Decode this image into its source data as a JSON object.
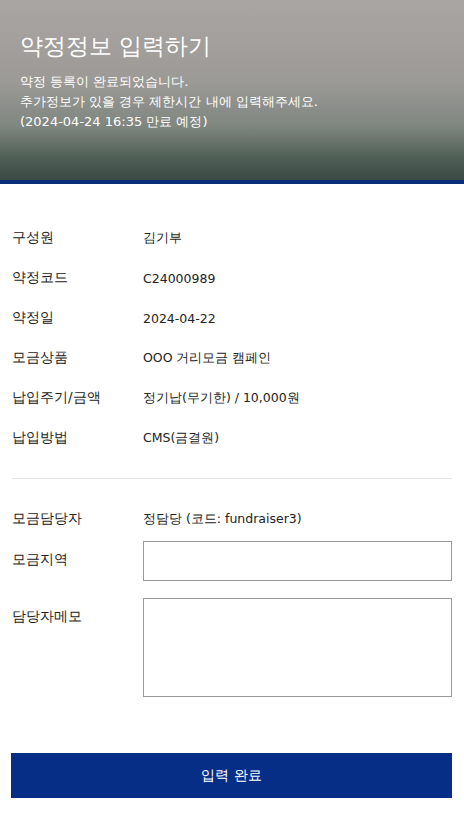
{
  "header": {
    "title": "약정정보 입력하기",
    "lines": [
      "약정 등록이 완료되었습니다.",
      "추가정보가 있을 경우 제한시간 내에 입력해주세요.",
      "(2024-04-24 16:35 만료 예정)"
    ]
  },
  "info": [
    {
      "label": "구성원",
      "value": "김기부"
    },
    {
      "label": "약정코드",
      "value": "C24000989"
    },
    {
      "label": "약정일",
      "value": "2024-04-22"
    },
    {
      "label": "모금상품",
      "value": "OOO 거리모금 캠페인"
    },
    {
      "label": "납입주기/금액",
      "value": "정기납(무기한) / 10,000원"
    },
    {
      "label": "납입방법",
      "value": "CMS(금결원)"
    }
  ],
  "staff": {
    "label": "모금담당자",
    "value": "정담당 (코드: fundraiser3)"
  },
  "fields": [
    {
      "label": "모금지역",
      "kind": "input"
    },
    {
      "label": "담당자메모",
      "kind": "textarea"
    }
  ],
  "button": "입력 완료"
}
